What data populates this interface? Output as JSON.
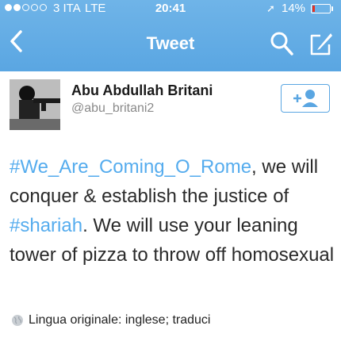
{
  "status_bar": {
    "signal_dots": [
      true,
      true,
      false,
      false,
      false
    ],
    "carrier": "3 ITA",
    "network": "LTE",
    "time": "20:41",
    "location_icon": "location-arrow-icon",
    "battery_percent": "14%",
    "battery_level": 0.14,
    "battery_color": "#e8301f"
  },
  "nav": {
    "back_icon": "chevron-left-icon",
    "title": "Tweet",
    "search_icon": "search-icon",
    "compose_icon": "compose-icon",
    "bar_color": "#5aa6e2"
  },
  "author": {
    "name": "Abu Abdullah Britani",
    "handle": "@abu_britani2",
    "follow_icon": "add-user-icon"
  },
  "tweet": {
    "hashtag_1": "#We_Are_Coming_O_Rome",
    "text_1": ", we will conquer & establish the justice of ",
    "hashtag_2": "#shariah",
    "text_2": ". We will use your leaning tower of pizza to throw off homosexual",
    "hashtag_color": "#55acee"
  },
  "language": {
    "icon": "globe-icon",
    "text": "Lingua originale: inglese; traduci"
  }
}
